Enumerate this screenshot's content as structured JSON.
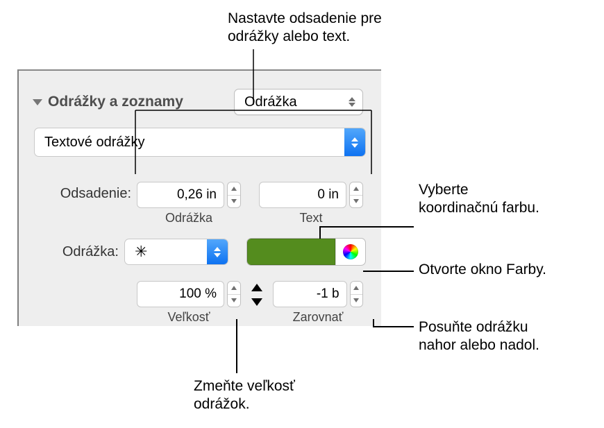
{
  "annotations": {
    "indent": "Nastavte odsadenie pre\nodrážky alebo text.",
    "coord": "Vyberte\nkoordinačnú farbu.",
    "colors": "Otvorte okno Farby.",
    "move": "Posuňte odrážku\nnahor alebo nadol.",
    "size": "Zmeňte veľkosť\nodrážok."
  },
  "panel": {
    "section_title": "Odrážky a zoznamy",
    "style_select": "Odrážka",
    "type_select": "Textové odrážky",
    "indent_label": "Odsadenie:",
    "indent_bullet_value": "0,26 in",
    "indent_bullet_caption": "Odrážka",
    "indent_text_value": "0 in",
    "indent_text_caption": "Text",
    "bullet_label": "Odrážka:",
    "bullet_char": "✳",
    "size_value": "100 %",
    "size_caption": "Veľkosť",
    "align_value": "-1 b",
    "align_caption": "Zarovnať"
  }
}
